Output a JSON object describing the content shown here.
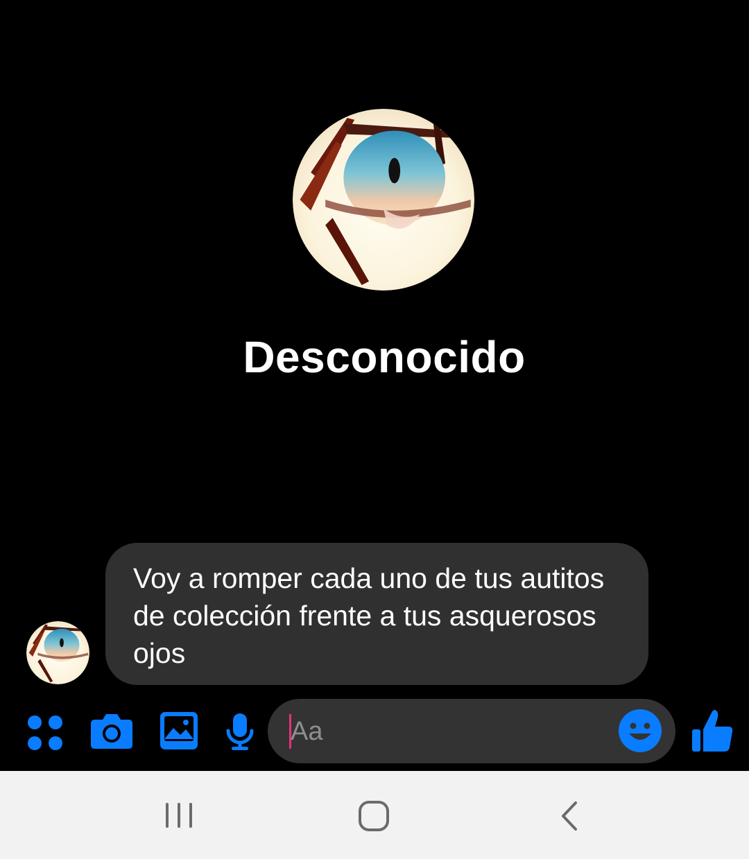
{
  "theme": {
    "background": "#000000",
    "accent": "#0a7cff",
    "bubble": "#303030",
    "input_background": "#333333",
    "caret": "#e8307a",
    "nav_background": "#f2f2f2",
    "nav_icon": "#6b6b6b"
  },
  "profile": {
    "name": "Desconocido",
    "avatar": "eye-avatar"
  },
  "messages": [
    {
      "sender": "other",
      "text": "Voy a romper cada uno de tus autitos de colección frente a tus asquerosos ojos"
    }
  ],
  "composer": {
    "icons": [
      "apps-icon",
      "camera-icon",
      "image-icon",
      "microphone-icon"
    ],
    "placeholder": "Aa",
    "value": "",
    "emoji_icon": "smiley-icon",
    "send_icon": "thumbs-up-icon"
  },
  "system_nav": {
    "icons": [
      "recent-apps-icon",
      "home-icon",
      "back-icon"
    ]
  }
}
